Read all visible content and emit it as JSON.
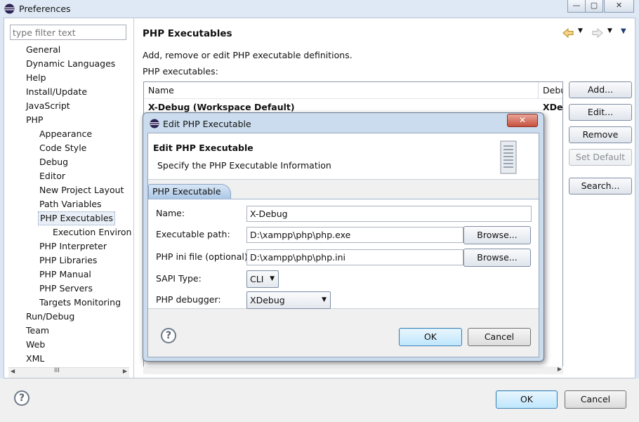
{
  "window": {
    "title": "Preferences",
    "controls": {
      "minimize": "—",
      "maximize": "▢",
      "close": "✕"
    }
  },
  "sidebar": {
    "filter_placeholder": "type filter text",
    "items": [
      {
        "label": "General"
      },
      {
        "label": "Dynamic Languages"
      },
      {
        "label": "Help"
      },
      {
        "label": "Install/Update"
      },
      {
        "label": "JavaScript"
      },
      {
        "label": "PHP"
      },
      {
        "label": "Appearance"
      },
      {
        "label": "Code Style"
      },
      {
        "label": "Debug"
      },
      {
        "label": "Editor"
      },
      {
        "label": "New Project Layout"
      },
      {
        "label": "Path Variables"
      },
      {
        "label": "PHP Executables"
      },
      {
        "label": "Execution Environ"
      },
      {
        "label": "PHP Interpreter"
      },
      {
        "label": "PHP Libraries"
      },
      {
        "label": "PHP Manual"
      },
      {
        "label": "PHP Servers"
      },
      {
        "label": "Targets Monitoring"
      },
      {
        "label": "Run/Debug"
      },
      {
        "label": "Team"
      },
      {
        "label": "Web"
      },
      {
        "label": "XML"
      }
    ],
    "scroll_thumb": "III"
  },
  "page": {
    "title": "PHP Executables",
    "description": "Add, remove or edit PHP executable definitions.",
    "list_label": "PHP executables:",
    "table": {
      "columns": [
        "Name",
        "Debu"
      ],
      "rows": [
        {
          "name": "X-Debug (Workspace Default)",
          "debugger": "XDel"
        }
      ]
    },
    "buttons": {
      "add": "Add...",
      "edit": "Edit...",
      "remove": "Remove",
      "set_default": "Set Default",
      "search": "Search..."
    },
    "scroll_thumb": "III"
  },
  "footer": {
    "help": "?",
    "ok": "OK",
    "cancel": "Cancel"
  },
  "dialog": {
    "title": "Edit PHP Executable",
    "close": "✕",
    "header_title": "Edit PHP Executable",
    "header_subtitle": "Specify the PHP Executable Information",
    "tab": "PHP Executable",
    "fields": {
      "name_label": "Name:",
      "name_value": "X-Debug",
      "exe_label": "Executable path:",
      "exe_value": "D:\\xampp\\php\\php.exe",
      "ini_label": "PHP ini file (optional):",
      "ini_value": "D:\\xampp\\php\\php.ini",
      "sapi_label": "SAPI Type:",
      "sapi_value": "CLI",
      "debugger_label": "PHP debugger:",
      "debugger_value": "XDebug"
    },
    "browse": "Browse...",
    "help": "?",
    "ok": "OK",
    "cancel": "Cancel"
  },
  "icons": {
    "app": "eclipse-icon",
    "nav_back": "arrow-left-icon",
    "nav_forward": "arrow-right-icon",
    "menu": "view-menu-icon",
    "server": "server-icon"
  }
}
